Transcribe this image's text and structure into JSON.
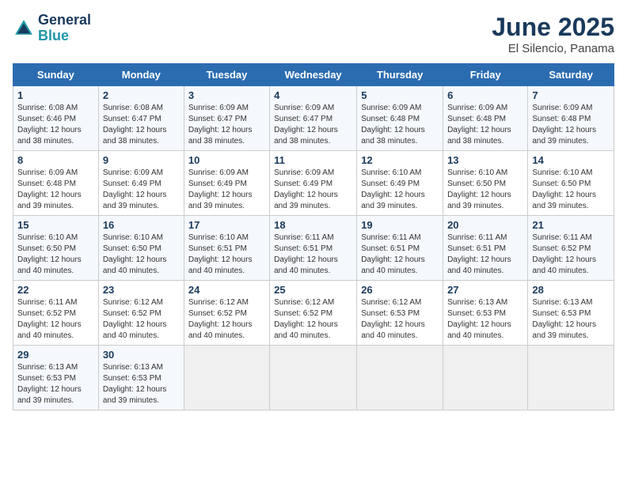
{
  "logo": {
    "line1": "General",
    "line2": "Blue"
  },
  "title": "June 2025",
  "subtitle": "El Silencio, Panama",
  "headers": [
    "Sunday",
    "Monday",
    "Tuesday",
    "Wednesday",
    "Thursday",
    "Friday",
    "Saturday"
  ],
  "weeks": [
    [
      {
        "day": "1",
        "sr": "6:08 AM",
        "ss": "6:46 PM",
        "dl": "12 hours and 38 minutes."
      },
      {
        "day": "2",
        "sr": "6:08 AM",
        "ss": "6:47 PM",
        "dl": "12 hours and 38 minutes."
      },
      {
        "day": "3",
        "sr": "6:09 AM",
        "ss": "6:47 PM",
        "dl": "12 hours and 38 minutes."
      },
      {
        "day": "4",
        "sr": "6:09 AM",
        "ss": "6:47 PM",
        "dl": "12 hours and 38 minutes."
      },
      {
        "day": "5",
        "sr": "6:09 AM",
        "ss": "6:48 PM",
        "dl": "12 hours and 38 minutes."
      },
      {
        "day": "6",
        "sr": "6:09 AM",
        "ss": "6:48 PM",
        "dl": "12 hours and 38 minutes."
      },
      {
        "day": "7",
        "sr": "6:09 AM",
        "ss": "6:48 PM",
        "dl": "12 hours and 39 minutes."
      }
    ],
    [
      {
        "day": "8",
        "sr": "6:09 AM",
        "ss": "6:48 PM",
        "dl": "12 hours and 39 minutes."
      },
      {
        "day": "9",
        "sr": "6:09 AM",
        "ss": "6:49 PM",
        "dl": "12 hours and 39 minutes."
      },
      {
        "day": "10",
        "sr": "6:09 AM",
        "ss": "6:49 PM",
        "dl": "12 hours and 39 minutes."
      },
      {
        "day": "11",
        "sr": "6:09 AM",
        "ss": "6:49 PM",
        "dl": "12 hours and 39 minutes."
      },
      {
        "day": "12",
        "sr": "6:10 AM",
        "ss": "6:49 PM",
        "dl": "12 hours and 39 minutes."
      },
      {
        "day": "13",
        "sr": "6:10 AM",
        "ss": "6:50 PM",
        "dl": "12 hours and 39 minutes."
      },
      {
        "day": "14",
        "sr": "6:10 AM",
        "ss": "6:50 PM",
        "dl": "12 hours and 39 minutes."
      }
    ],
    [
      {
        "day": "15",
        "sr": "6:10 AM",
        "ss": "6:50 PM",
        "dl": "12 hours and 40 minutes."
      },
      {
        "day": "16",
        "sr": "6:10 AM",
        "ss": "6:50 PM",
        "dl": "12 hours and 40 minutes."
      },
      {
        "day": "17",
        "sr": "6:10 AM",
        "ss": "6:51 PM",
        "dl": "12 hours and 40 minutes."
      },
      {
        "day": "18",
        "sr": "6:11 AM",
        "ss": "6:51 PM",
        "dl": "12 hours and 40 minutes."
      },
      {
        "day": "19",
        "sr": "6:11 AM",
        "ss": "6:51 PM",
        "dl": "12 hours and 40 minutes."
      },
      {
        "day": "20",
        "sr": "6:11 AM",
        "ss": "6:51 PM",
        "dl": "12 hours and 40 minutes."
      },
      {
        "day": "21",
        "sr": "6:11 AM",
        "ss": "6:52 PM",
        "dl": "12 hours and 40 minutes."
      }
    ],
    [
      {
        "day": "22",
        "sr": "6:11 AM",
        "ss": "6:52 PM",
        "dl": "12 hours and 40 minutes."
      },
      {
        "day": "23",
        "sr": "6:12 AM",
        "ss": "6:52 PM",
        "dl": "12 hours and 40 minutes."
      },
      {
        "day": "24",
        "sr": "6:12 AM",
        "ss": "6:52 PM",
        "dl": "12 hours and 40 minutes."
      },
      {
        "day": "25",
        "sr": "6:12 AM",
        "ss": "6:52 PM",
        "dl": "12 hours and 40 minutes."
      },
      {
        "day": "26",
        "sr": "6:12 AM",
        "ss": "6:53 PM",
        "dl": "12 hours and 40 minutes."
      },
      {
        "day": "27",
        "sr": "6:13 AM",
        "ss": "6:53 PM",
        "dl": "12 hours and 40 minutes."
      },
      {
        "day": "28",
        "sr": "6:13 AM",
        "ss": "6:53 PM",
        "dl": "12 hours and 39 minutes."
      }
    ],
    [
      {
        "day": "29",
        "sr": "6:13 AM",
        "ss": "6:53 PM",
        "dl": "12 hours and 39 minutes."
      },
      {
        "day": "30",
        "sr": "6:13 AM",
        "ss": "6:53 PM",
        "dl": "12 hours and 39 minutes."
      },
      null,
      null,
      null,
      null,
      null
    ]
  ]
}
